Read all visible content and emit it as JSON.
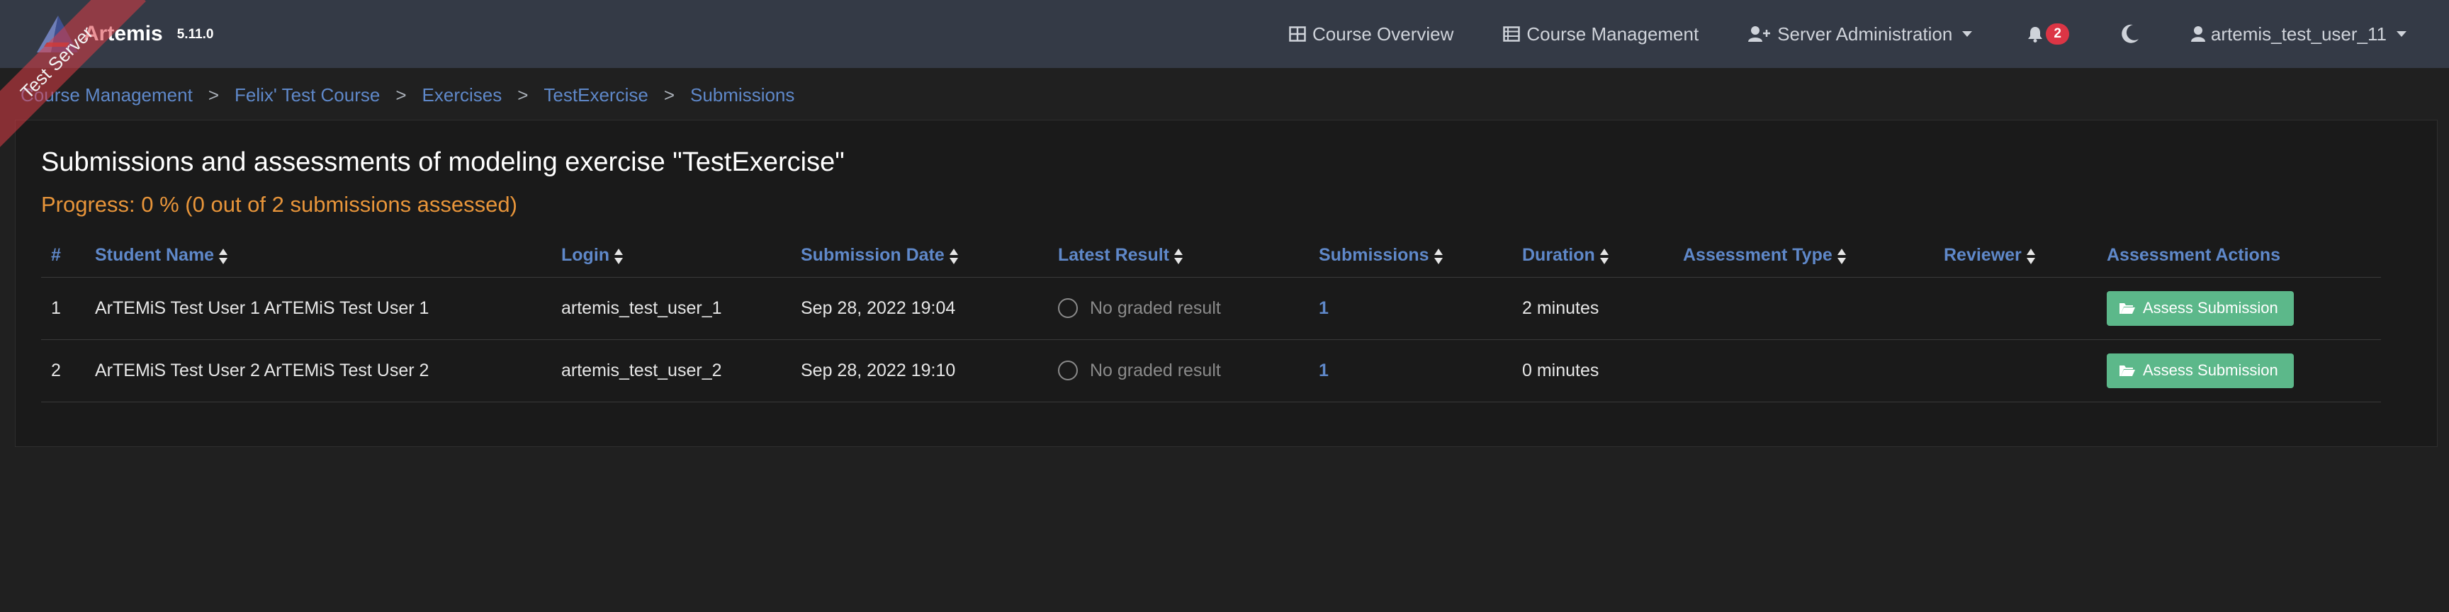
{
  "brand": {
    "name": "Artemis",
    "version": "5.11.0",
    "ribbon": "Test Server"
  },
  "nav": {
    "course_overview": "Course Overview",
    "course_management": "Course Management",
    "server_administration": "Server Administration",
    "notification_count": "2",
    "user": "artemis_test_user_11"
  },
  "breadcrumb": [
    "Course Management",
    "Felix' Test Course",
    "Exercises",
    "TestExercise",
    "Submissions"
  ],
  "breadcrumb_separator": ">",
  "page": {
    "title": "Submissions and assessments of modeling exercise \"TestExercise\"",
    "progress": "Progress: 0 % (0 out of 2 submissions assessed)"
  },
  "table": {
    "headers": [
      "#",
      "Student Name",
      "Login",
      "Submission Date",
      "Latest Result",
      "Submissions",
      "Duration",
      "Assessment Type",
      "Reviewer",
      "Assessment Actions"
    ],
    "rows": [
      {
        "index": "1",
        "student_name": "ArTEMiS Test User 1 ArTEMiS Test User 1",
        "login": "artemis_test_user_1",
        "submission_date": "Sep 28, 2022 19:04",
        "latest_result": "No graded result",
        "submissions": "1",
        "duration": "2 minutes",
        "assessment_type": "",
        "reviewer": "",
        "action": "Assess Submission"
      },
      {
        "index": "2",
        "student_name": "ArTEMiS Test User 2 ArTEMiS Test User 2",
        "login": "artemis_test_user_2",
        "submission_date": "Sep 28, 2022 19:10",
        "latest_result": "No graded result",
        "submissions": "1",
        "duration": "0 minutes",
        "assessment_type": "",
        "reviewer": "",
        "action": "Assess Submission"
      }
    ]
  },
  "colors": {
    "navbar": "#343a46",
    "link": "#5f88c9",
    "progress": "#e8953a",
    "assess_button": "#5cb88a",
    "badge": "#dc3545"
  },
  "icons": {
    "course_overview": "table-icon",
    "course_management": "list-icon",
    "server_administration": "user-plus-icon",
    "notifications": "bell-icon",
    "theme": "moon-icon",
    "user": "user-icon",
    "sort": "sort-icon",
    "result": "circle-icon",
    "assess": "folder-open-icon"
  }
}
